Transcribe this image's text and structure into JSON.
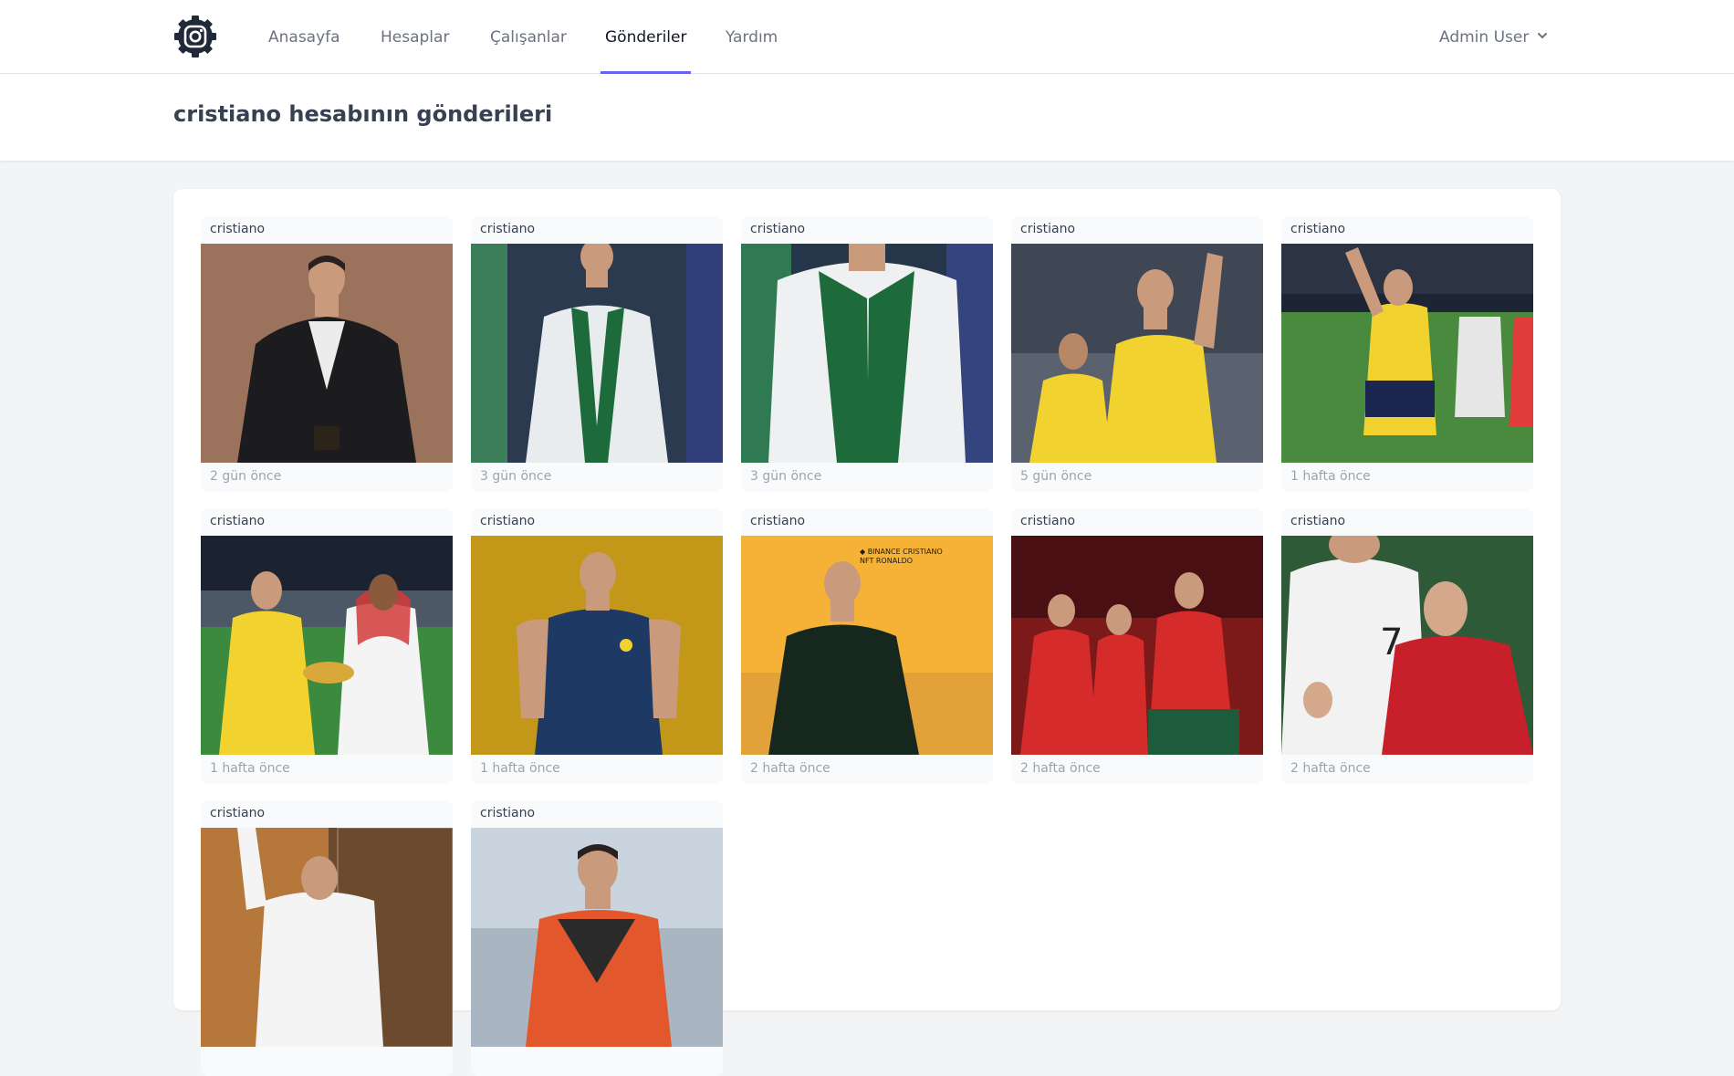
{
  "nav": {
    "logo_icon": "instagram-gear-icon",
    "items": [
      {
        "label": "Anasayfa",
        "active": false
      },
      {
        "label": "Hesaplar",
        "active": false
      },
      {
        "label": "Çalışanlar",
        "active": false
      },
      {
        "label": "Gönderiler",
        "active": true
      },
      {
        "label": "Yardım",
        "active": false
      }
    ],
    "user": {
      "label": "Admin User",
      "icon": "chevron-down-icon"
    }
  },
  "header": {
    "title": "cristiano hesabının gönderileri"
  },
  "posts": [
    {
      "username": "cristiano",
      "time": "2 gün önce"
    },
    {
      "username": "cristiano",
      "time": "3 gün önce"
    },
    {
      "username": "cristiano",
      "time": "3 gün önce"
    },
    {
      "username": "cristiano",
      "time": "5 gün önce"
    },
    {
      "username": "cristiano",
      "time": "1 hafta önce"
    },
    {
      "username": "cristiano",
      "time": "1 hafta önce"
    },
    {
      "username": "cristiano",
      "time": "1 hafta önce"
    },
    {
      "username": "cristiano",
      "time": "2 hafta önce"
    },
    {
      "username": "cristiano",
      "time": "2 hafta önce"
    },
    {
      "username": "cristiano",
      "time": "2 hafta önce"
    },
    {
      "username": "cristiano",
      "time": ""
    },
    {
      "username": "cristiano",
      "time": ""
    }
  ],
  "colors": {
    "accent": "#6366f1",
    "page_bg": "#f3f4f6"
  }
}
